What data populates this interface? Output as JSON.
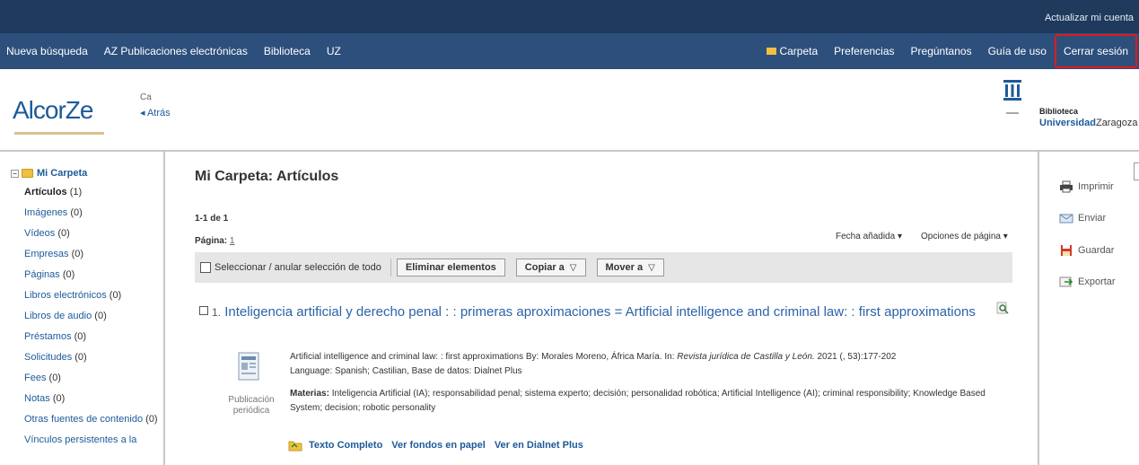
{
  "topbar": {
    "account": "Actualizar mi cuenta"
  },
  "nav": {
    "left": [
      "Nueva búsqueda",
      "AZ Publicaciones electrónicas",
      "Biblioteca",
      "UZ"
    ],
    "right": [
      "Carpeta",
      "Preferencias",
      "Pregúntanos",
      "Guía de uso"
    ],
    "logout": "Cerrar sesión"
  },
  "header": {
    "logo": "AlcorZe",
    "breadcrumb": "Ca",
    "back": "◂ Atrás",
    "library_small": "Biblioteca",
    "library_uni": "Universidad",
    "library_city": "Zaragoza"
  },
  "sidebar": {
    "root": "Mi Carpeta",
    "items": [
      {
        "label": "Artículos",
        "count": "(1)"
      },
      {
        "label": "Imágenes",
        "count": "(0)"
      },
      {
        "label": "Vídeos",
        "count": "(0)"
      },
      {
        "label": "Empresas",
        "count": "(0)"
      },
      {
        "label": "Páginas",
        "count": "(0)"
      },
      {
        "label": "Libros electrónicos",
        "count": "(0)"
      },
      {
        "label": "Libros de audio",
        "count": "(0)"
      },
      {
        "label": "Préstamos",
        "count": "(0)"
      },
      {
        "label": "Solicitudes",
        "count": "(0)"
      },
      {
        "label": "Fees",
        "count": "(0)"
      },
      {
        "label": "Notas",
        "count": "(0)"
      },
      {
        "label": "Otras fuentes de contenido",
        "count": "(0)"
      },
      {
        "label": "Vínculos persistentes a la",
        "count": ""
      }
    ]
  },
  "main": {
    "title": "Mi Carpeta: Artículos",
    "count": "1-1 de 1",
    "page_label": "Página:",
    "page_num": "1",
    "sort": "Fecha añadida ▾",
    "page_options": "Opciones de página ▾",
    "select_all": "Seleccionar / anular selección de todo",
    "delete_btn": "Eliminar elementos",
    "copy_btn": "Copiar a",
    "move_btn": "Mover a",
    "tri": "▽"
  },
  "result": {
    "num": "1.",
    "title": "Inteligencia artificial y derecho penal : : primeras aproximaciones = Artificial intelligence and criminal law: : first approximations",
    "pubtype": "Publicación periódica",
    "meta_a": "Artificial intelligence and criminal law: : first approximations By: Morales Moreno, África María. In:",
    "meta_journal": "Revista jurídica de Castilla y León.",
    "meta_b": "2021 (, 53):177-202",
    "meta_lang": "Language: Spanish; Castilian, Base de datos: Dialnet Plus",
    "materias_label": "Materias:",
    "materias": "Inteligencia Artificial (IA); responsabilidad penal; sistema experto; decisión; personalidad robótica; Artificial Intelligence (AI); criminal responsibility; Knowledge Based System; decision; robotic personality",
    "links": [
      "Texto Completo",
      "Ver fondos en papel",
      "Ver en Dialnet Plus"
    ]
  },
  "tools": [
    "Imprimir",
    "Enviar",
    "Guardar",
    "Exportar"
  ],
  "colors": {
    "topbar": "#1f3a5c",
    "navbar": "#2d4f7c",
    "link": "#1d5a9a",
    "highlight": "#e01b1b"
  }
}
